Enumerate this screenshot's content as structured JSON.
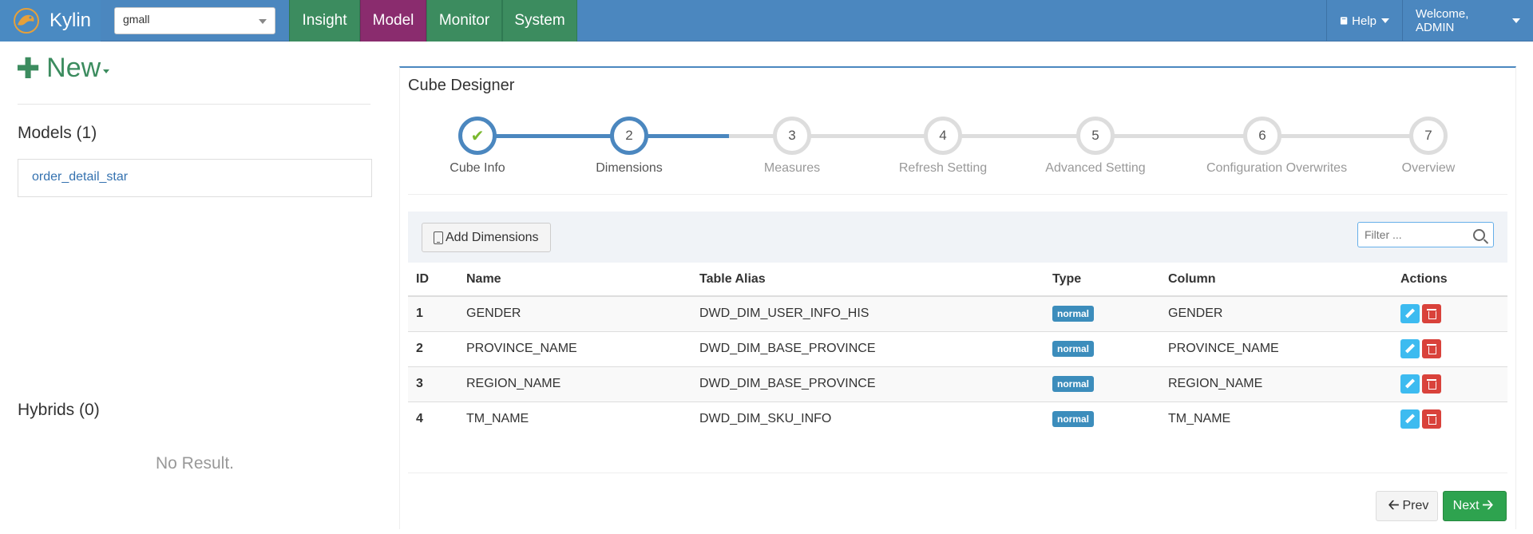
{
  "header": {
    "brand": "Kylin",
    "project": "gmall",
    "tabs": [
      {
        "label": "Insight",
        "active": false
      },
      {
        "label": "Model",
        "active": true
      },
      {
        "label": "Monitor",
        "active": false
      },
      {
        "label": "System",
        "active": false
      }
    ],
    "help_label": "Help",
    "welcome_label": "Welcome, ADMIN"
  },
  "sidebar": {
    "new_label": "New",
    "models_heading": "Models (1)",
    "models": [
      "order_detail_star"
    ],
    "hybrids_heading": "Hybrids (0)",
    "hybrids_empty": "No Result."
  },
  "designer": {
    "title": "Cube Designer",
    "steps": [
      {
        "number": "1",
        "label": "Cube Info",
        "state": "done"
      },
      {
        "number": "2",
        "label": "Dimensions",
        "state": "current"
      },
      {
        "number": "3",
        "label": "Measures",
        "state": "todo"
      },
      {
        "number": "4",
        "label": "Refresh Setting",
        "state": "todo"
      },
      {
        "number": "5",
        "label": "Advanced Setting",
        "state": "todo"
      },
      {
        "number": "6",
        "label": "Configuration Overwrites",
        "state": "todo"
      },
      {
        "number": "7",
        "label": "Overview",
        "state": "todo"
      }
    ],
    "add_dimensions_label": "Add Dimensions",
    "filter_placeholder": "Filter ...",
    "columns": [
      "ID",
      "Name",
      "Table Alias",
      "Type",
      "Column",
      "Actions"
    ],
    "rows": [
      {
        "id": "1",
        "name": "GENDER",
        "table": "DWD_DIM_USER_INFO_HIS",
        "type": "normal",
        "column": "GENDER"
      },
      {
        "id": "2",
        "name": "PROVINCE_NAME",
        "table": "DWD_DIM_BASE_PROVINCE",
        "type": "normal",
        "column": "PROVINCE_NAME"
      },
      {
        "id": "3",
        "name": "REGION_NAME",
        "table": "DWD_DIM_BASE_PROVINCE",
        "type": "normal",
        "column": "REGION_NAME"
      },
      {
        "id": "4",
        "name": "TM_NAME",
        "table": "DWD_DIM_SKU_INFO",
        "type": "normal",
        "column": "TM_NAME"
      }
    ],
    "prev_label": "Prev",
    "next_label": "Next"
  },
  "colors": {
    "navbar": "#4b87bf",
    "tab": "#3c8c5f",
    "tab_active": "#8a2c6e",
    "next_button": "#2ea34f"
  }
}
